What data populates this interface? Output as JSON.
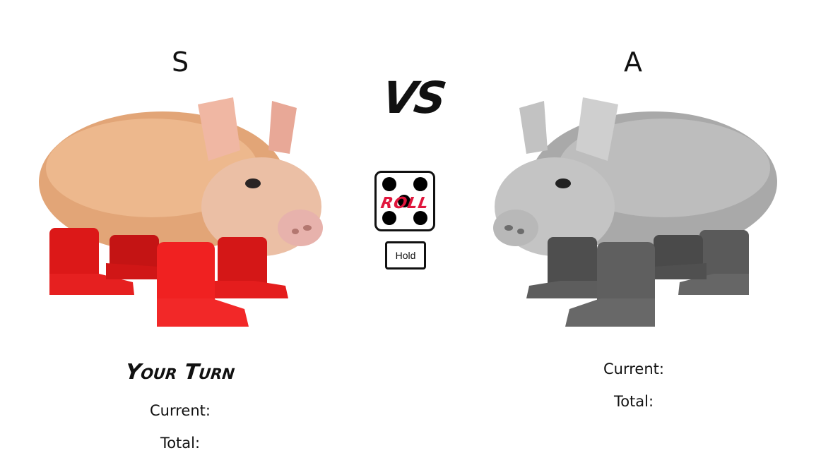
{
  "players": [
    {
      "name": "S",
      "turn_label": "Your Turn",
      "current_label": "Current:",
      "total_label": "Total:"
    },
    {
      "name": "A",
      "current_label": "Current:",
      "total_label": "Total:"
    }
  ],
  "center": {
    "vs_label": "VS",
    "roll_label": "ROLL",
    "hold_label": "Hold"
  },
  "colors": {
    "roll_accent": "#e0163c",
    "boots_active": "#e01a1a",
    "boots_inactive": "#555555",
    "pig_active": "#e8a878",
    "pig_inactive": "#b5b5b5"
  },
  "icons": [
    "pig-icon",
    "die-icon"
  ]
}
